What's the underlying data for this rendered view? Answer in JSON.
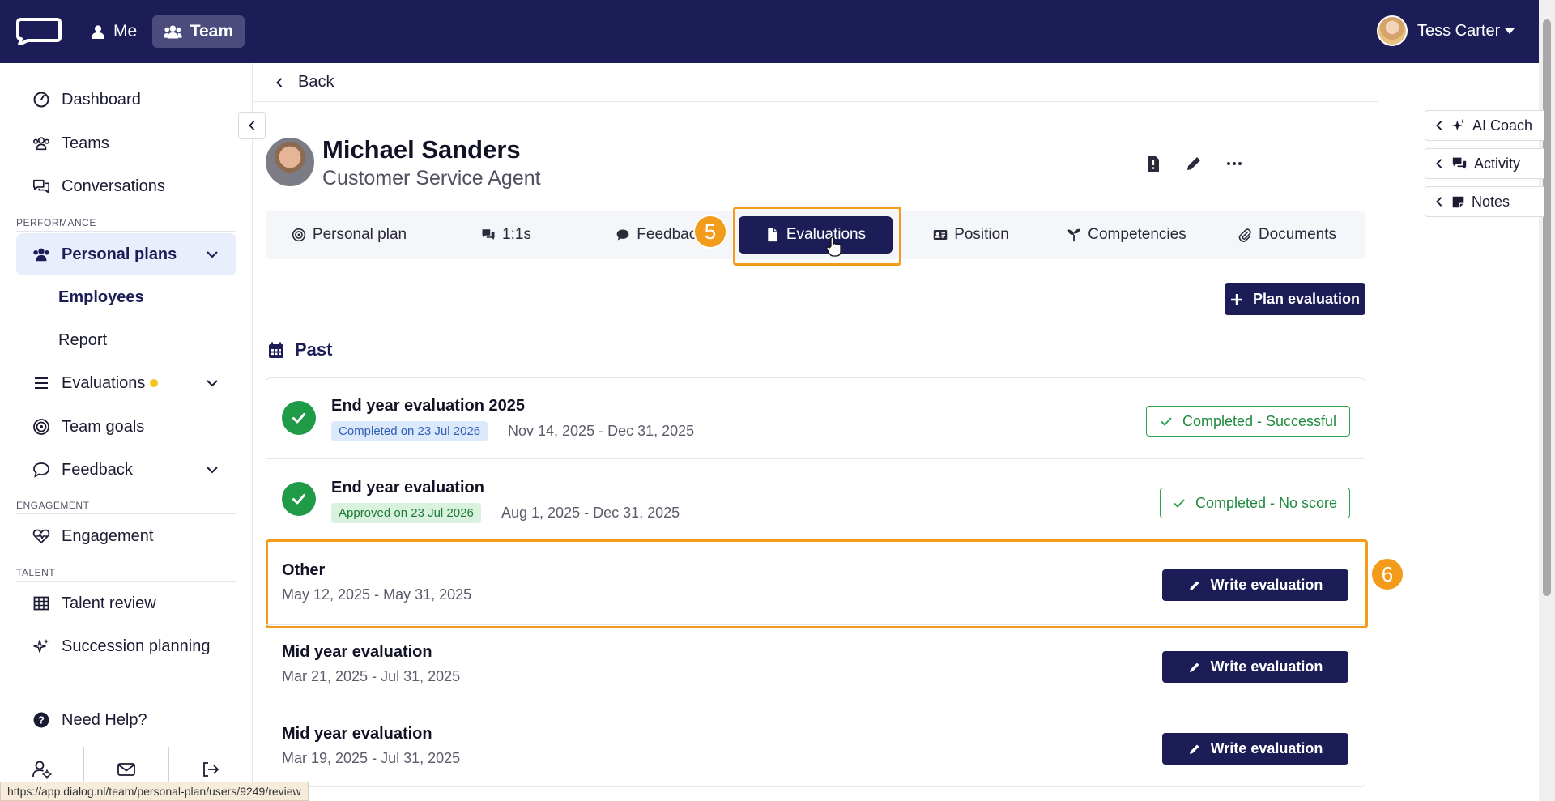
{
  "topbar": {
    "nav": [
      {
        "label": "Me",
        "icon": "user-icon"
      },
      {
        "label": "Team",
        "icon": "team-icon",
        "active": true
      }
    ],
    "user_name": "Tess Carter",
    "colors": {
      "background": "#1c1d57",
      "active_nav": "#4b4c7d"
    }
  },
  "sidebar": {
    "items": [
      {
        "label": "Dashboard",
        "icon": "gauge-icon"
      },
      {
        "label": "Teams",
        "icon": "team-icon"
      },
      {
        "label": "Conversations",
        "icon": "chat-icon"
      }
    ],
    "section_performance": "PERFORMANCE",
    "personal_plans": {
      "label": "Personal plans",
      "icon": "team-icon",
      "expanded": true
    },
    "sub_items": [
      {
        "label": "Employees",
        "active": true
      },
      {
        "label": "Report"
      }
    ],
    "evaluations": {
      "label": "Evaluations",
      "icon": "list-icon",
      "indicator_color": "#f5c518"
    },
    "team_goals": {
      "label": "Team goals",
      "icon": "target-icon"
    },
    "feedback": {
      "label": "Feedback",
      "icon": "speech-bubble-icon"
    },
    "section_engagement": "ENGAGEMENT",
    "engagement": {
      "label": "Engagement",
      "icon": "heart-pulse-icon"
    },
    "section_talent": "TALENT",
    "talent_review": {
      "label": "Talent review",
      "icon": "grid-icon"
    },
    "succession_planning": {
      "label": "Succession planning",
      "icon": "sparkle-icon"
    },
    "need_help": {
      "label": "Need Help?",
      "icon": "question-icon"
    },
    "bottom_icons": [
      "user-settings-icon",
      "mail-icon",
      "logout-icon"
    ]
  },
  "statusbar": {
    "url": "https://app.dialog.nl/team/personal-plan/users/9249/review"
  },
  "main": {
    "back_label": "Back",
    "employee": {
      "name": "Michael Sanders",
      "role": "Customer Service Agent"
    },
    "header_icons": [
      "document-alert-icon",
      "pencil-icon",
      "more-icon"
    ],
    "tabs": [
      {
        "label": "Personal plan",
        "icon": "target-icon"
      },
      {
        "label": "1:1s",
        "icon": "chat-icon"
      },
      {
        "label": "Feedback",
        "icon": "speech-bubble-icon"
      },
      {
        "label": "Evaluations",
        "icon": "document-icon",
        "active": true
      },
      {
        "label": "Position",
        "icon": "id-card-icon"
      },
      {
        "label": "Competencies",
        "icon": "seedling-icon"
      },
      {
        "label": "Documents",
        "icon": "paperclip-icon"
      }
    ],
    "step_badges": [
      "5",
      "6"
    ],
    "plan_evaluation_label": "Plan evaluation",
    "section_title": "Past",
    "evaluations": [
      {
        "title": "End year evaluation 2025",
        "badge": "Completed on 23 Jul 2026",
        "dates": "Nov 14, 2025 - Dec 31, 2025",
        "status": "Completed - Successful"
      },
      {
        "title": "End year evaluation",
        "badge": "Approved on 23 Jul 2026",
        "dates": "Aug 1, 2025 - Dec 31, 2025",
        "status": "Completed - No score"
      },
      {
        "title": "Other",
        "dates": "May 12, 2025 - May 31, 2025",
        "action": "Write evaluation",
        "highlighted": true
      },
      {
        "title": "Mid year evaluation",
        "dates": "Mar 21, 2025 - Jul 31, 2025",
        "action": "Write evaluation"
      },
      {
        "title": "Mid year evaluation",
        "dates": "Mar 19, 2025 - Jul 31, 2025",
        "action": "Write evaluation"
      }
    ],
    "colors": {
      "primary": "#1c1d57",
      "success": "#1f9a46",
      "highlight": "#f39b1a"
    }
  },
  "right_panels": [
    {
      "label": "AI Coach",
      "icon": "sparkle-icon"
    },
    {
      "label": "Activity",
      "icon": "chat-icon"
    },
    {
      "label": "Notes",
      "icon": "note-icon"
    }
  ]
}
